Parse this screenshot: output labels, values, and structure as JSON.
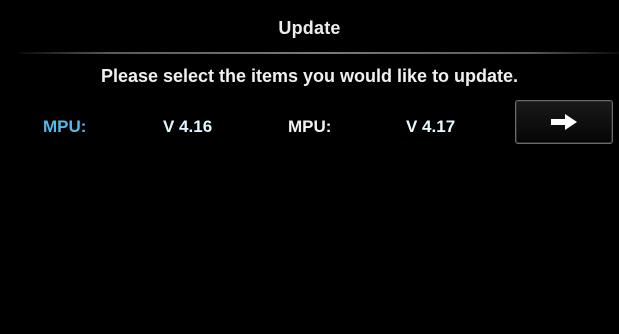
{
  "screen": {
    "title": "Update",
    "instruction": "Please select the items you would like to update."
  },
  "update_item": {
    "current_label": "MPU:",
    "current_version": "V 4.16",
    "new_label": "MPU:",
    "new_version": "V 4.17",
    "next_button_icon": "right-arrow-icon"
  },
  "colors": {
    "background": "#000000",
    "text": "#efefef",
    "accent_label": "#56b8e8",
    "divider": "#7a7a7a"
  }
}
